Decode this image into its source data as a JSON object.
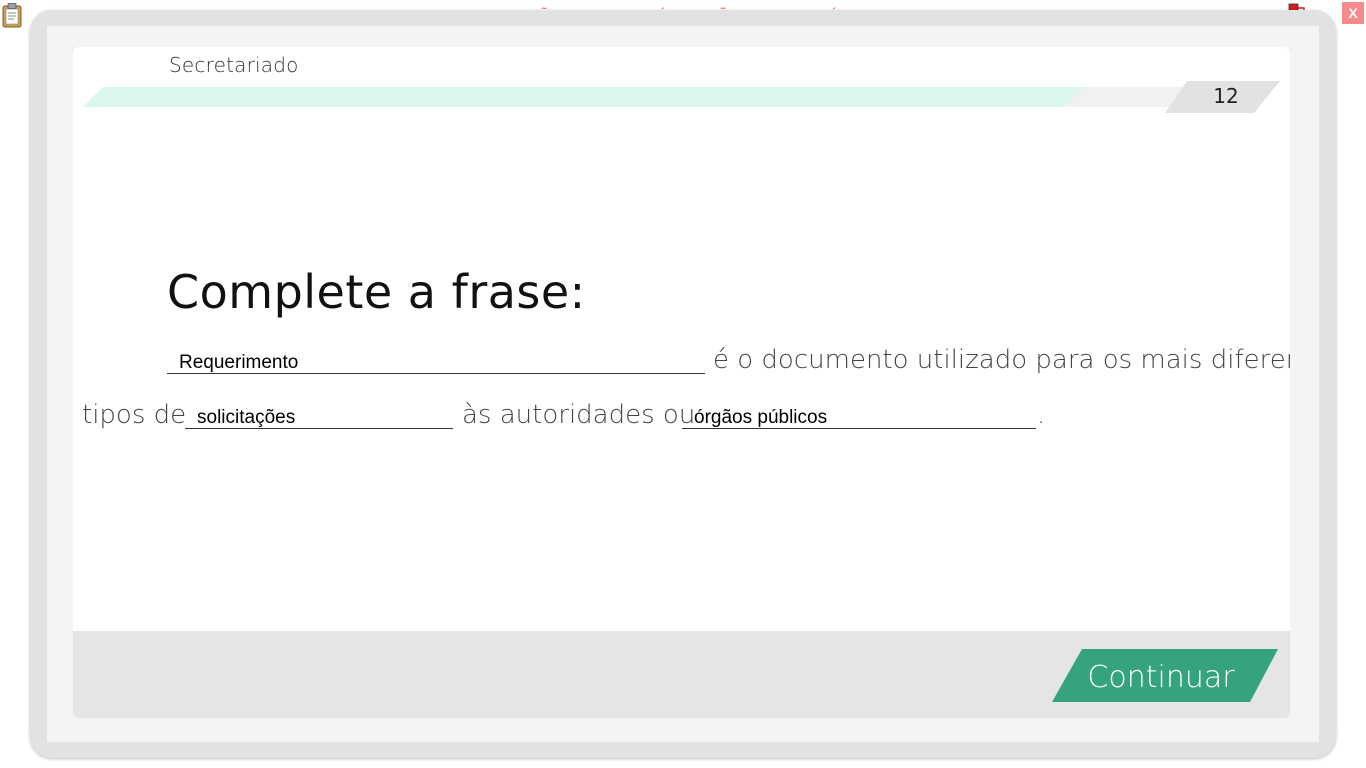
{
  "watermark": "VERSÃO PARA FUNCIONÁRIOS - NÃO COMERCIALIZÁVEL",
  "close_label": "X",
  "course": {
    "title": "Secretariado"
  },
  "progress": {
    "fraction": 0.9,
    "page_number": "12"
  },
  "question": {
    "heading": "Complete a frase:",
    "sentence": {
      "part1": "é o documento utilizado para os mais diferentes",
      "part2": "tipos de",
      "part3": "às autoridades ou",
      "part4": "."
    },
    "blanks": {
      "blank1": "Requerimento",
      "blank2": "solicitações",
      "blank3": "órgãos públicos"
    }
  },
  "continue_label": "Continuar",
  "colors": {
    "accent": "#35a37c",
    "progress_fill": "#dcf7ef",
    "panel_gray": "#e1e2e4",
    "watermark_red": "#f07070"
  },
  "icons": {
    "top_left": "clipboard-icon",
    "top_right": "network-status-icon",
    "close": "close-icon"
  }
}
